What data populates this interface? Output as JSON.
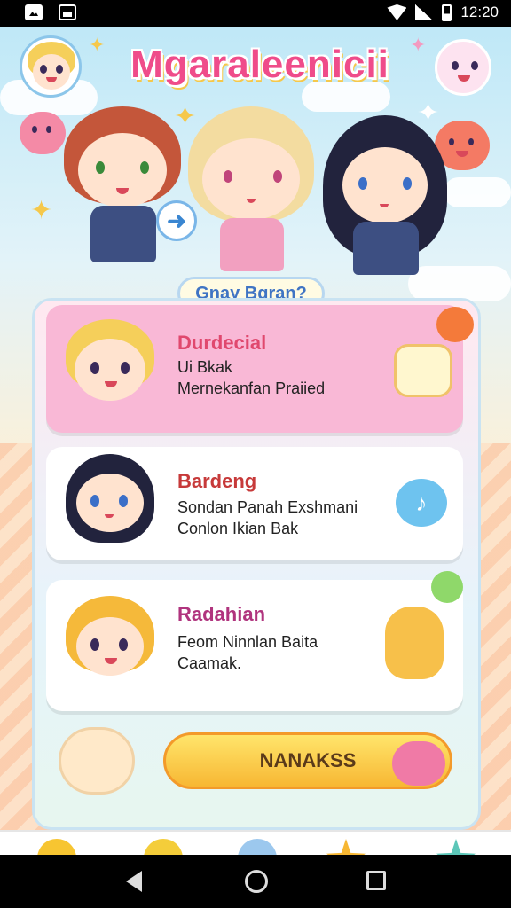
{
  "status_bar": {
    "time": "12:20",
    "icons": [
      "gallery-icon",
      "image-icon",
      "wifi-icon",
      "signal-icon",
      "battery-icon"
    ]
  },
  "app": {
    "title": "Mgaraleenicii",
    "hero_button": "Gnay Bgran?"
  },
  "cards": [
    {
      "title": "Durdecial",
      "lines": [
        "Ui Bkak",
        "Mernekanfan Praiied"
      ],
      "title_color": "#e0486e"
    },
    {
      "title": "Bardeng",
      "lines": [
        "Sondan Panah Exshmani",
        "Conlon Ikian Bak"
      ],
      "title_color": "#c73a3a"
    },
    {
      "title": "Radahian",
      "lines": [
        "Feom Ninnlan Baita",
        "Caamak."
      ],
      "title_color": "#b0347e"
    }
  ],
  "cta": {
    "label": "NANAKSS"
  },
  "bottom_nav": {
    "items": [
      {
        "icon": "smile-icon",
        "color": "#f7c531"
      },
      {
        "icon": "happy-face-icon",
        "color": "#f4cd3a"
      },
      {
        "icon": "bubble-icon",
        "color": "#9cc8ee"
      },
      {
        "icon": "star-icon",
        "color": "#f7b733"
      },
      {
        "icon": "teal-star-icon",
        "color": "#5cc6b8"
      }
    ]
  },
  "colors": {
    "title_pink": "#ef4c8a",
    "card_pink": "#f9b8d6",
    "cta_yellow": "#f7b733"
  }
}
